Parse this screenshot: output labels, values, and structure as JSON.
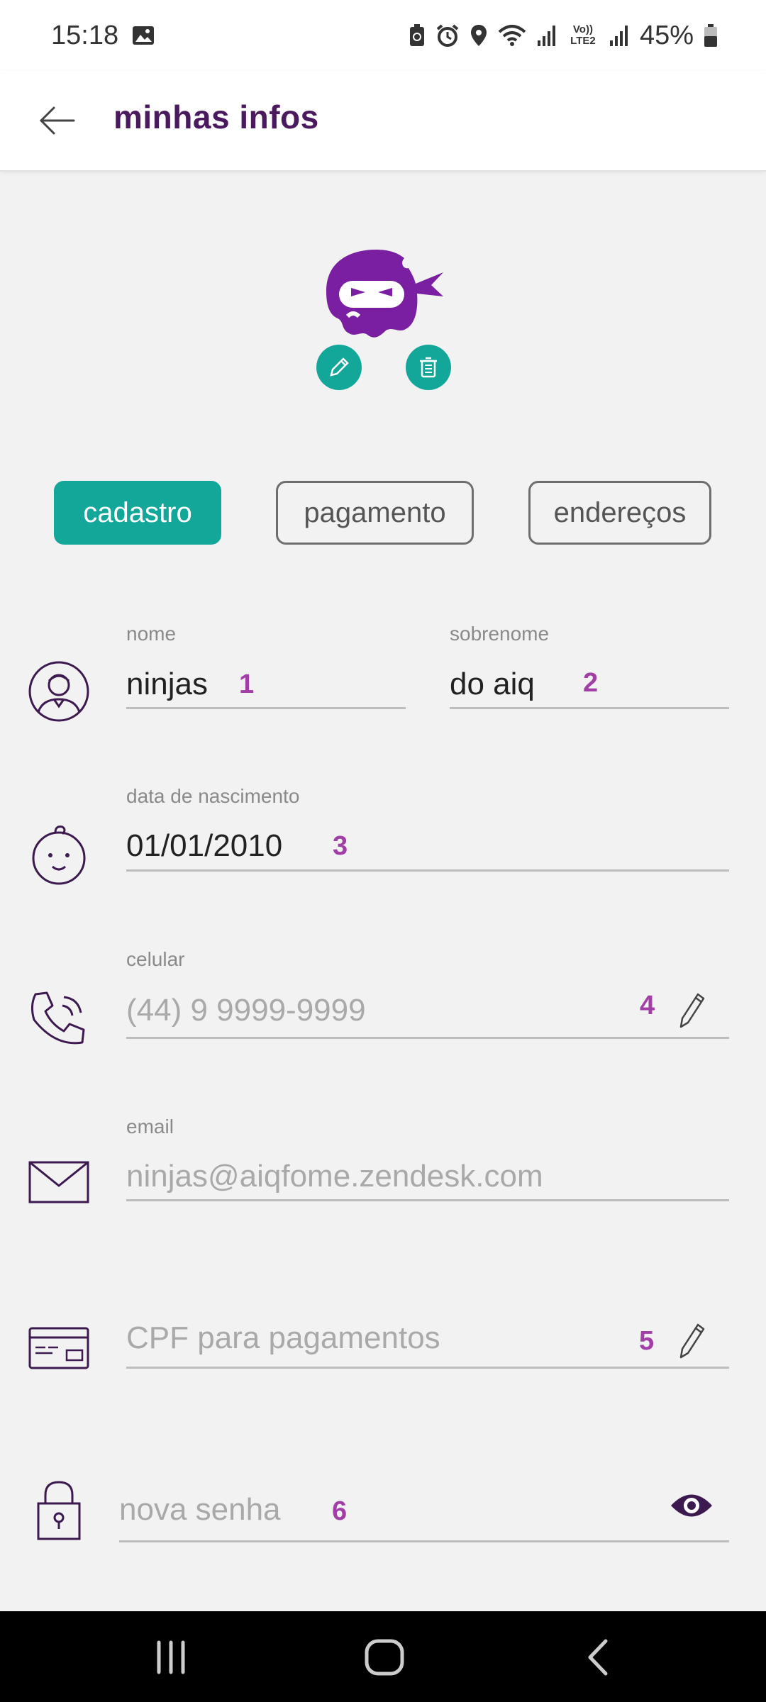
{
  "status_bar": {
    "time": "15:18",
    "battery": "45%",
    "volte_label": "Vo)) LTE2",
    "icons": [
      "image-icon",
      "battery-saver-icon",
      "alarm-icon",
      "location-icon",
      "wifi-icon",
      "signal-icon",
      "volte-icon",
      "signal-icon-2",
      "battery-icon"
    ]
  },
  "app_bar": {
    "title": "minhas infos"
  },
  "avatar": {
    "edit_icon": "pencil-icon",
    "delete_icon": "trash-icon"
  },
  "tabs": [
    {
      "label": "cadastro",
      "active": true
    },
    {
      "label": "pagamento",
      "active": false
    },
    {
      "label": "endereços",
      "active": false
    }
  ],
  "form": {
    "nome": {
      "label": "nome",
      "value": "ninjas",
      "marker": "1"
    },
    "sobrenome": {
      "label": "sobrenome",
      "value": "do aiq",
      "marker": "2"
    },
    "nascimento": {
      "label": "data de nascimento",
      "value": "01/01/2010",
      "marker": "3"
    },
    "celular": {
      "label": "celular",
      "placeholder": "(44) 9 9999-9999",
      "marker": "4"
    },
    "email": {
      "label": "email",
      "placeholder": "ninjas@aiqfome.zendesk.com"
    },
    "cpf": {
      "placeholder": "CPF para pagamentos",
      "marker": "5"
    },
    "senha": {
      "placeholder": "nova senha",
      "marker": "6"
    }
  },
  "colors": {
    "accent": "#13a79a",
    "brand_purple": "#7b1fa2",
    "title_purple": "#4b1a5e",
    "marker_purple": "#a23fa6"
  }
}
